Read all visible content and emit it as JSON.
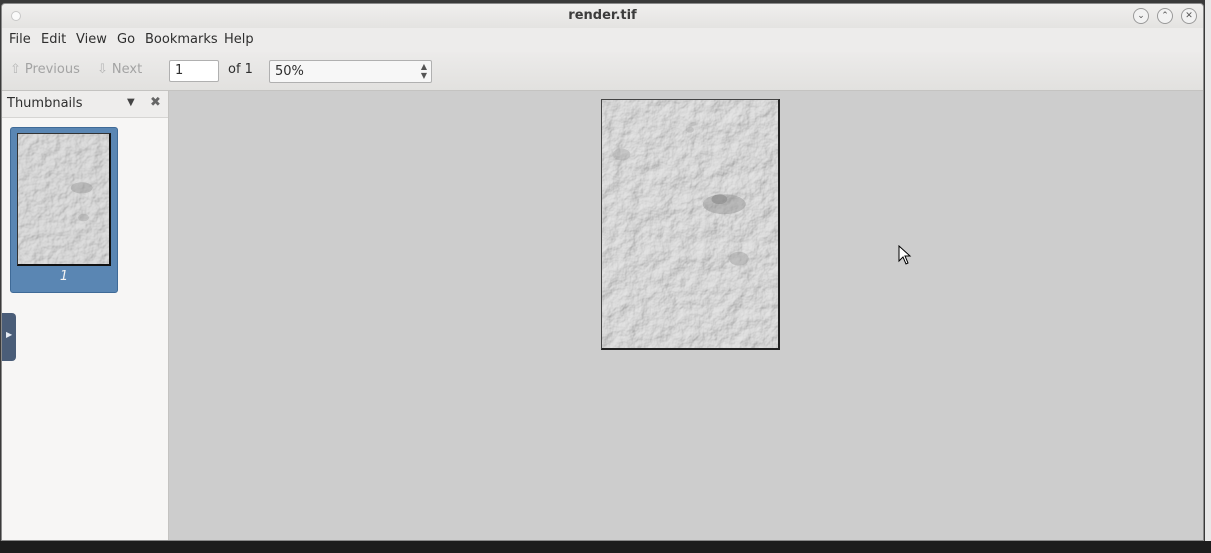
{
  "window": {
    "title": "render.tif"
  },
  "menubar": {
    "items": [
      "File",
      "Edit",
      "View",
      "Go",
      "Bookmarks",
      "Help"
    ]
  },
  "toolbar": {
    "previous_label": "Previous",
    "next_label": "Next",
    "page_value": "1",
    "page_of": "of 1",
    "zoom_value": "50%"
  },
  "sidebar": {
    "title": "Thumbnails",
    "thumbnails": [
      {
        "label": "1"
      }
    ]
  },
  "document": {
    "current_page": 1,
    "total_pages": 1
  },
  "colors": {
    "thumbnail_selected": "#5a86b3",
    "document_background": "#cdcdcd",
    "sidebar_handle": "#4a5d78"
  },
  "icons": {
    "previous": "arrow-up-icon",
    "next": "arrow-down-icon",
    "sidebar_dropdown": "triangle-down-icon",
    "sidebar_close": "close-icon"
  }
}
